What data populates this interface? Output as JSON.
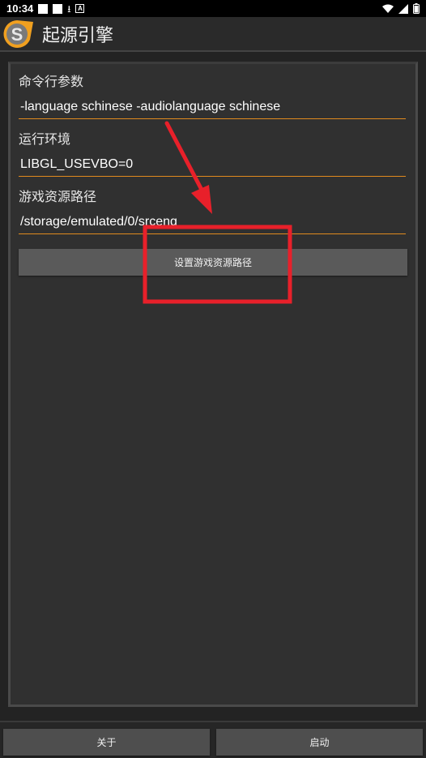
{
  "status_bar": {
    "time": "10:34"
  },
  "app": {
    "title": "起源引擎",
    "logo_letter": "S"
  },
  "form": {
    "cmdline_label": "命令行参数",
    "cmdline_value": "-language schinese -audiolanguage schinese",
    "env_label": "运行环境",
    "env_value": "LIBGL_USEVBO=0",
    "gamepath_label": "游戏资源路径",
    "gamepath_value": "/storage/emulated/0/srceng",
    "set_path_button": "设置游戏资源路径"
  },
  "footer": {
    "about_button": "关于",
    "launch_button": "启动"
  },
  "colors": {
    "accent_underline": "#e08a1e",
    "annotation_red": "#e8202a"
  }
}
